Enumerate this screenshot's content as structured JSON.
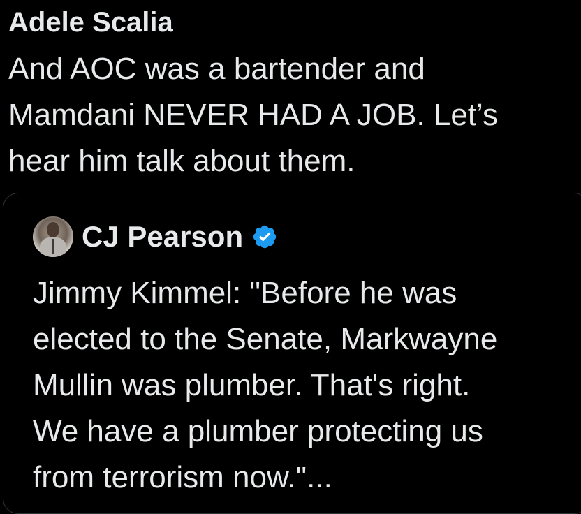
{
  "post": {
    "author_name": "Adele Scalia",
    "text_lines": [
      "And AOC was a bartender and",
      "Mamdani NEVER HAD A JOB. Let’s",
      "hear him talk about them."
    ]
  },
  "quoted_post": {
    "author_name": "CJ Pearson",
    "verified": true,
    "verified_icon": "verified-badge-icon",
    "text_lines": [
      "Jimmy Kimmel: \"Before he was",
      "elected to the Senate, Markwayne",
      "Mullin was plumber. That's right.",
      "We have a plumber protecting us",
      "from terrorism now.\"..."
    ]
  },
  "colors": {
    "background": "#000000",
    "text": "#e7e9ea",
    "border": "#2f3336",
    "verified": "#1d9bf0"
  }
}
